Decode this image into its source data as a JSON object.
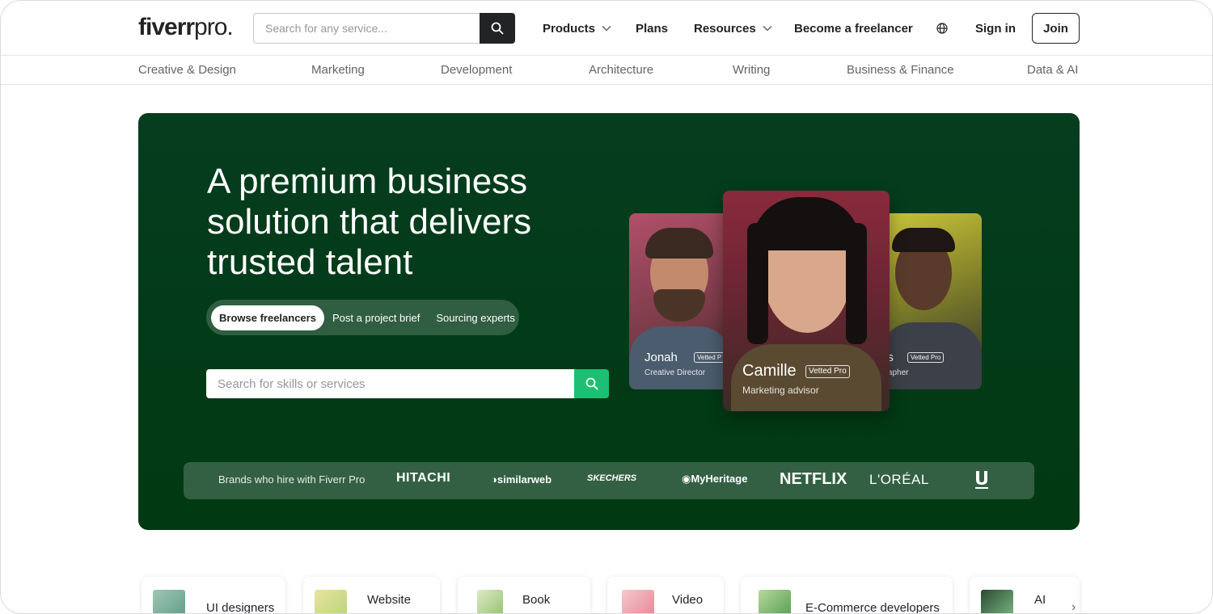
{
  "header": {
    "logo_main": "fiverr",
    "logo_suffix": "pro.",
    "search_placeholder": "Search for any service...",
    "nav": {
      "products": "Products",
      "plans": "Plans",
      "resources": "Resources",
      "become_freelancer": "Become a freelancer",
      "sign_in": "Sign in",
      "join": "Join"
    }
  },
  "categories": [
    "Creative & Design",
    "Marketing",
    "Development",
    "Architecture",
    "Writing",
    "Business & Finance",
    "Data & AI"
  ],
  "hero": {
    "title": "A premium business solution that delivers trusted talent",
    "tabs": [
      "Browse freelancers",
      "Post a project brief",
      "Sourcing experts"
    ],
    "search_placeholder": "Search for skills or services",
    "profiles": {
      "left": {
        "name": "Jonah",
        "badge": "Vetted P",
        "role": "Creative Director"
      },
      "center": {
        "name": "Camille",
        "badge": "Vetted Pro",
        "role": "Marketing advisor"
      },
      "right": {
        "name": "es",
        "badge": "Vetted Pro",
        "role": "grapher"
      }
    },
    "brands_label": "Brands who hire with Fiverr Pro",
    "brands": [
      "HITACHI",
      "similarweb",
      "SKECHERS",
      "MyHeritage",
      "NETFLIX",
      "L'ORÉAL",
      "Unilever"
    ]
  },
  "services": [
    "UI designers",
    "Website",
    "Book",
    "Video",
    "E-Commerce developers",
    "AI"
  ],
  "colors": {
    "hero_bg": "#053d1f",
    "accent_green": "#1dbf73",
    "dark": "#222325"
  }
}
